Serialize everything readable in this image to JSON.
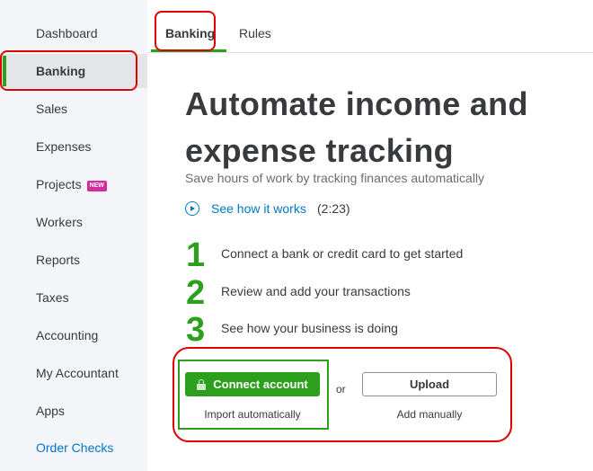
{
  "sidebar": {
    "items": [
      {
        "label": "Dashboard"
      },
      {
        "label": "Banking"
      },
      {
        "label": "Sales"
      },
      {
        "label": "Expenses"
      },
      {
        "label": "Projects",
        "badge": "NEW"
      },
      {
        "label": "Workers"
      },
      {
        "label": "Reports"
      },
      {
        "label": "Taxes"
      },
      {
        "label": "Accounting"
      },
      {
        "label": "My Accountant"
      },
      {
        "label": "Apps"
      },
      {
        "label": "Order Checks"
      }
    ]
  },
  "tabs": [
    {
      "label": "Banking"
    },
    {
      "label": "Rules"
    }
  ],
  "main": {
    "headline_line1": "Automate income and",
    "headline_line2": "expense tracking",
    "subtitle": "Save hours of work by tracking finances automatically",
    "video_link": "See how it works",
    "video_duration": "(2:23)",
    "steps": [
      {
        "number": "1",
        "text": "Connect a bank or credit card to get started"
      },
      {
        "number": "2",
        "text": "Review and add your transactions"
      },
      {
        "number": "3",
        "text": "See how your business is doing"
      }
    ],
    "connect_button": "Connect account",
    "connect_caption": "Import automatically",
    "or_label": "or",
    "upload_button": "Upload",
    "upload_caption": "Add manually"
  },
  "colors": {
    "brand_green": "#2ca01c",
    "link_blue": "#0077c5",
    "annotation_red": "#e00000",
    "badge_pink": "#d52b9c"
  }
}
